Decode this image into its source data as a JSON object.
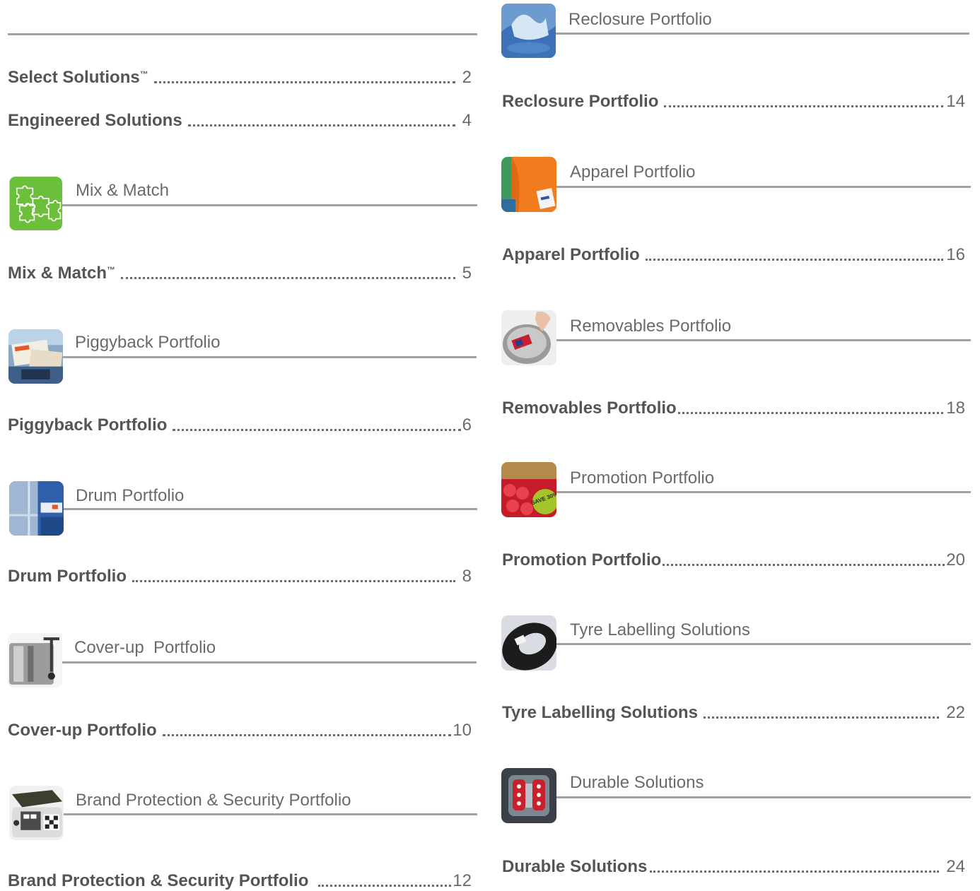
{
  "left": {
    "top_entries": [
      {
        "label": "Select Solutions",
        "sup": "™",
        "page": "2"
      },
      {
        "label": "Engineered Solutions",
        "sup": "",
        "page": "4"
      }
    ],
    "sections": [
      {
        "title": "Mix & Match",
        "entry": {
          "label": "Mix & Match",
          "sup": "™",
          "page": "5"
        },
        "icon": "puzzle-icon"
      },
      {
        "title": "Piggyback Portfolio",
        "entry": {
          "label": "Piggyback Portfolio",
          "sup": "",
          "page": "6"
        },
        "icon": "piggyback-thumbnail"
      },
      {
        "title": "Drum Portfolio",
        "entry": {
          "label": "Drum Portfolio",
          "sup": "",
          "page": "8"
        },
        "icon": "drum-thumbnail"
      },
      {
        "title": "Cover-up  Portfolio",
        "entry": {
          "label": "Cover-up Portfolio",
          "sup": "",
          "page": "10"
        },
        "icon": "toaster-thumbnail"
      },
      {
        "title": "Brand Protection & Security Portfolio",
        "entry": {
          "label": "Brand Protection & Security Portfolio",
          "sup": "",
          "page": "12"
        },
        "icon": "security-device-thumbnail"
      }
    ]
  },
  "right": {
    "sections": [
      {
        "title": "Reclosure Portfolio",
        "entry": {
          "label": "Reclosure Portfolio",
          "page": "14"
        },
        "icon": "wipes-pack-thumbnail"
      },
      {
        "title": "Apparel Portfolio",
        "entry": {
          "label": "Apparel Portfolio",
          "page": "16"
        },
        "icon": "apparel-thumbnail"
      },
      {
        "title": "Removables Portfolio",
        "entry": {
          "label": "Removables Portfolio",
          "page": "18"
        },
        "icon": "cookware-thumbnail"
      },
      {
        "title": "Promotion Portfolio",
        "entry": {
          "label": "Promotion Portfolio",
          "page": "20"
        },
        "icon": "promotion-thumbnail"
      },
      {
        "title": "Tyre Labelling Solutions",
        "entry": {
          "label": "Tyre Labelling Solutions",
          "page": "22"
        },
        "icon": "tyre-thumbnail"
      },
      {
        "title": "Durable Solutions",
        "entry": {
          "label": "Durable Solutions",
          "page": "24"
        },
        "icon": "engine-thumbnail"
      }
    ],
    "promo_badge": "SAVE 30%"
  },
  "colors": {
    "rule": "#a2a2a2",
    "text": "#5f5f5f",
    "puzzle_green": "#6cbf3a"
  }
}
